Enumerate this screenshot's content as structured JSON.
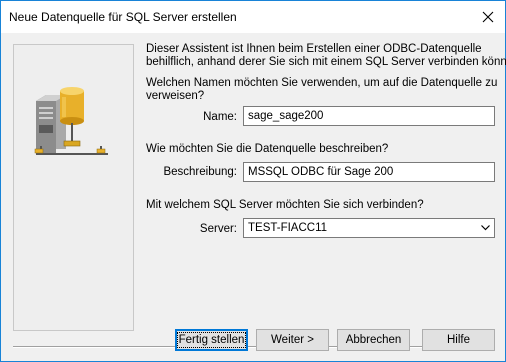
{
  "window": {
    "title": "Neue Datenquelle für SQL Server erstellen"
  },
  "intro": {
    "line1": "Dieser Assistent ist Ihnen beim Erstellen einer ODBC-Datenquelle",
    "line2": "behilflich, anhand derer Sie sich mit einem SQL Server verbinden können."
  },
  "name_section": {
    "question_line1": "Welchen Namen möchten Sie verwenden, um auf die Datenquelle zu",
    "question_line2": "verweisen?",
    "label": "Name:",
    "value": "sage_sage200"
  },
  "description_section": {
    "question": "Wie möchten Sie die Datenquelle beschreiben?",
    "label": "Beschreibung:",
    "value": "MSSQL ODBC für Sage 200"
  },
  "server_section": {
    "question": "Mit welchem SQL Server möchten Sie sich verbinden?",
    "label": "Server:",
    "value": "TEST-FIACC11"
  },
  "buttons": {
    "finish": "Fertig stellen",
    "next": "Weiter >",
    "cancel": "Abbrechen",
    "help": "Hilfe"
  },
  "icons": {
    "close": "close-icon",
    "illustration": "server-database-network-icon",
    "dropdown": "chevron-down-icon"
  },
  "colors": {
    "window_border": "#1883d7",
    "dialog_background": "#f0f0f0",
    "default_button_border": "#0078d7",
    "database_gold": "#e8b02a"
  }
}
